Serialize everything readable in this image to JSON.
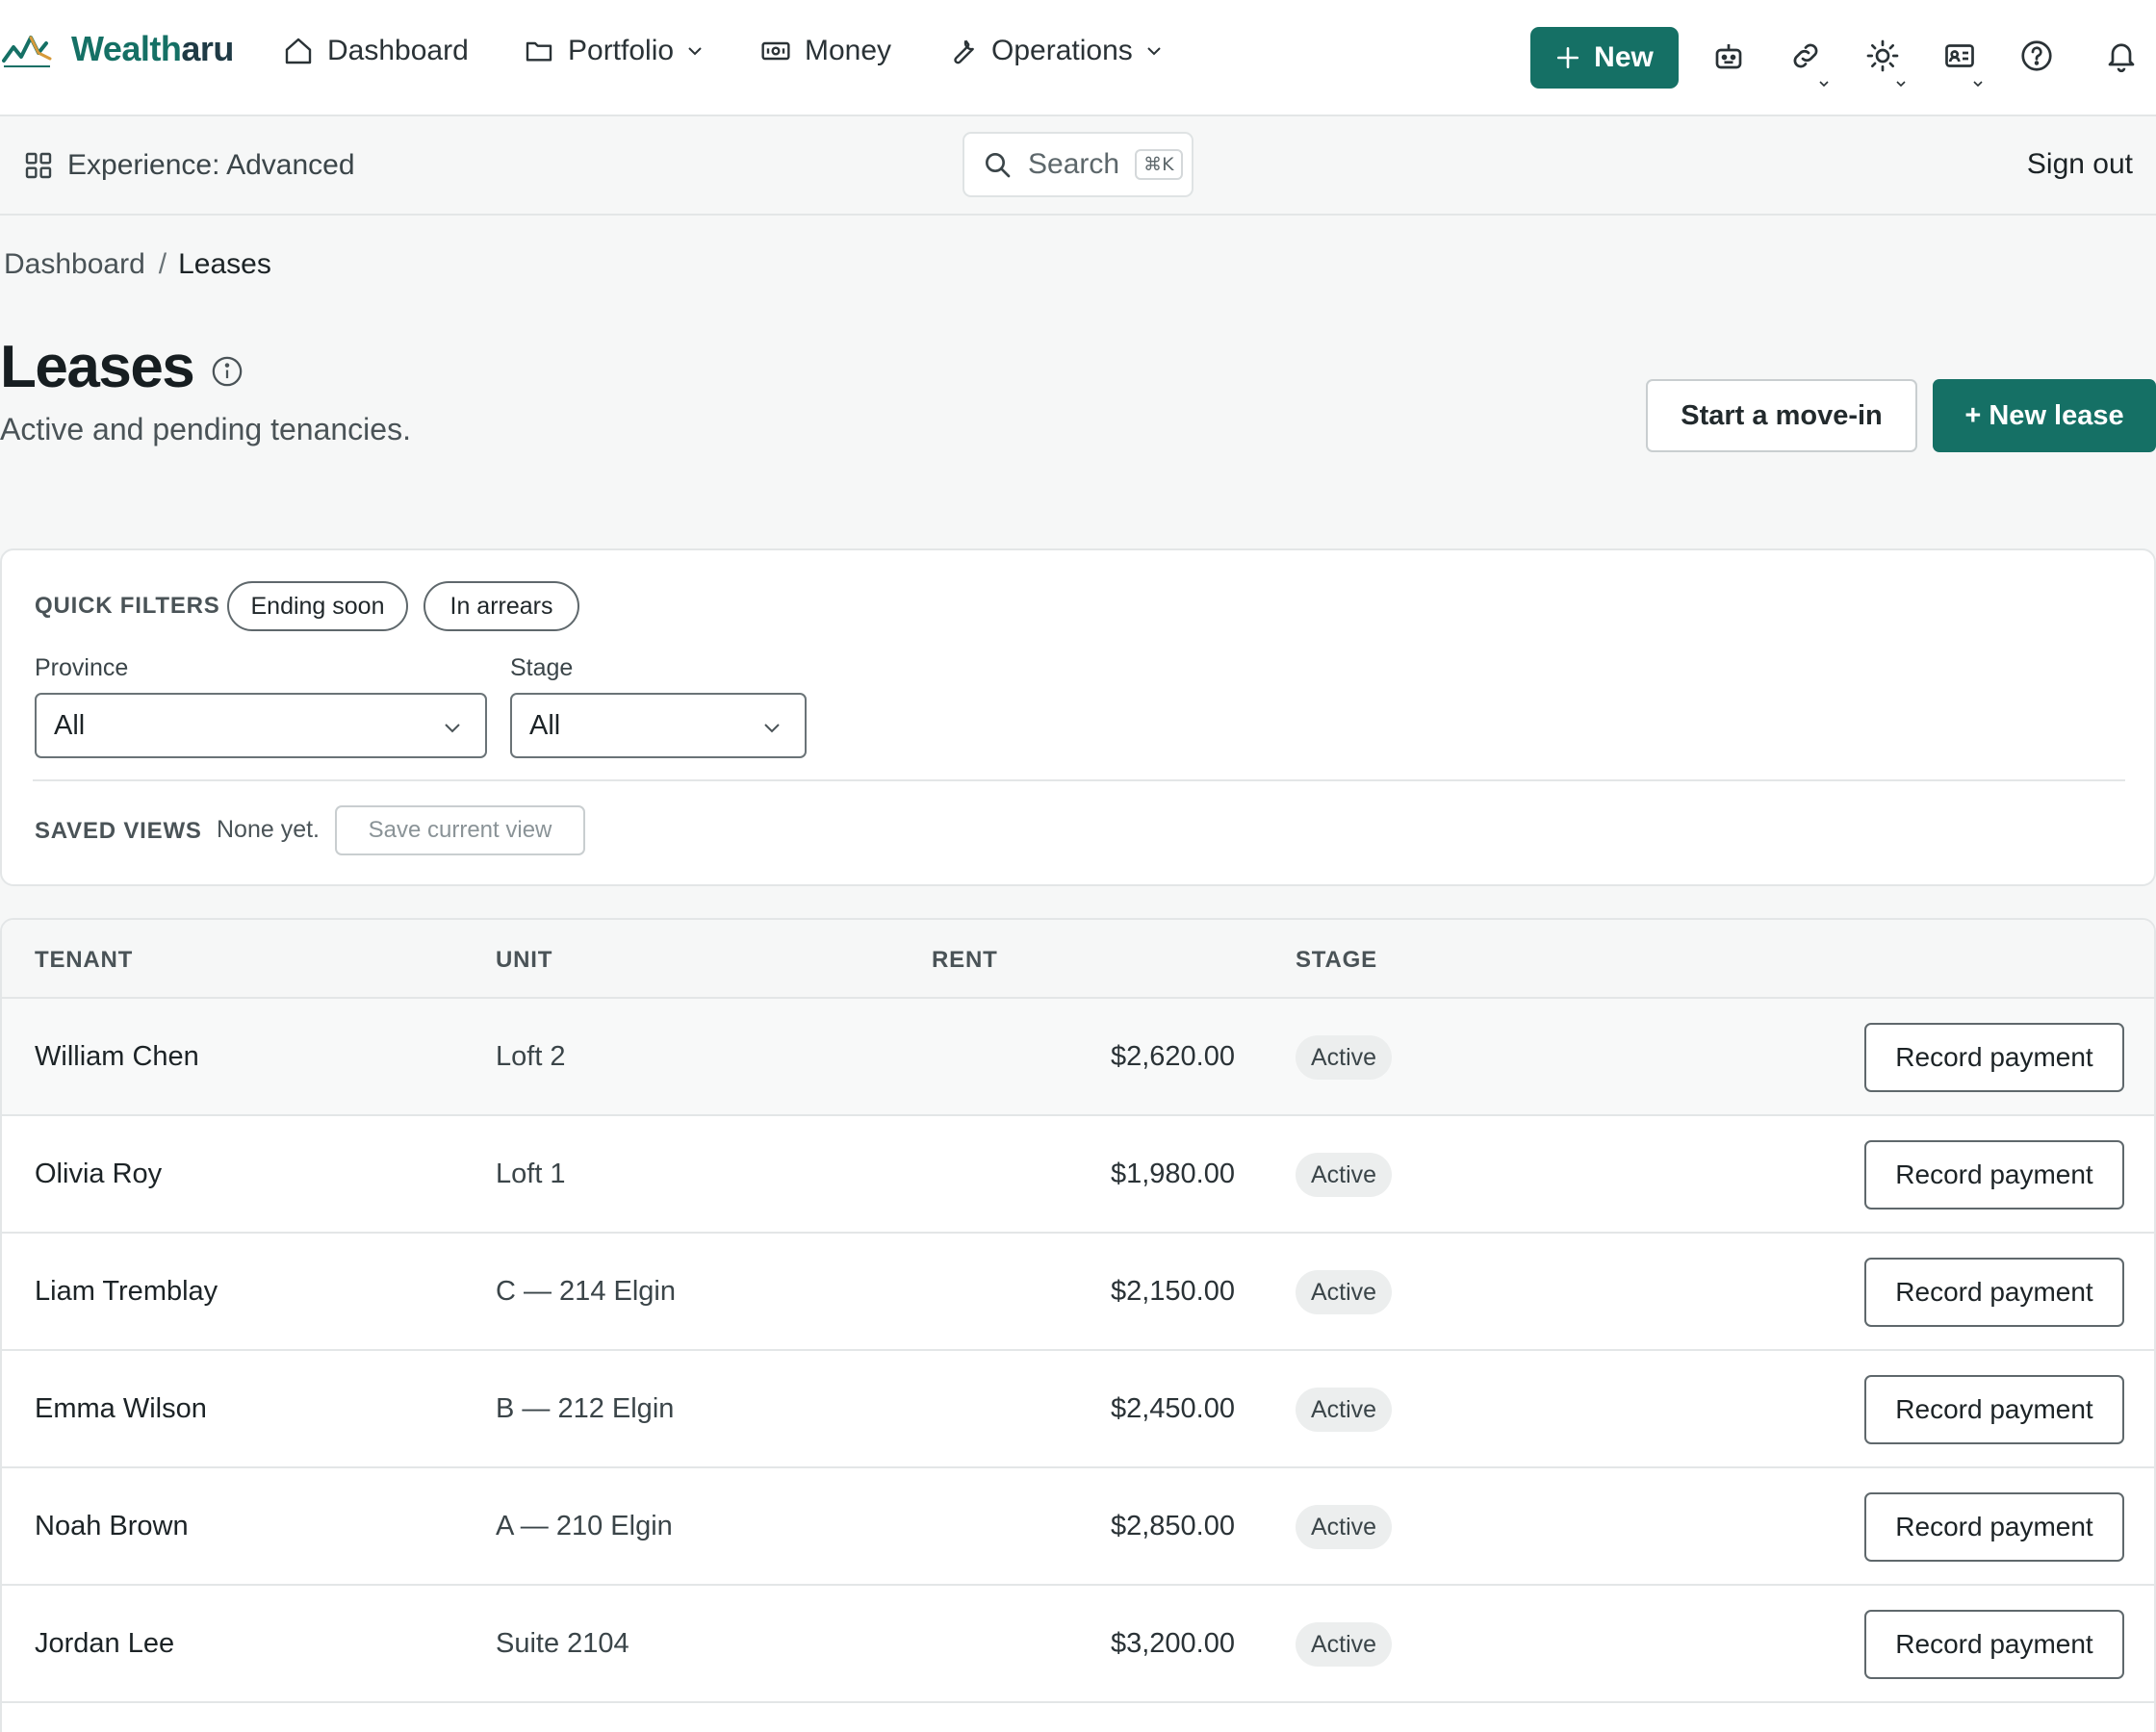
{
  "brand": {
    "name_part1": "Wealth",
    "name_part2": "aru"
  },
  "nav": {
    "dashboard": "Dashboard",
    "portfolio": "Portfolio",
    "money": "Money",
    "operations": "Operations",
    "new_label": "New"
  },
  "icons": {
    "assistant": "robot-icon",
    "links": "link-icon",
    "theme": "sun-icon",
    "profile": "id-card-icon",
    "help": "help-circle-icon",
    "notifications": "bell-icon"
  },
  "subbar": {
    "experience": "Experience: Advanced",
    "search_label": "Search",
    "search_shortcut": "⌘K",
    "sign_out": "Sign out"
  },
  "breadcrumb": {
    "root": "Dashboard",
    "separator": "/",
    "current": "Leases"
  },
  "page": {
    "title": "Leases",
    "subtitle": "Active and pending tenancies.",
    "start_move_in": "Start a move-in",
    "new_lease": "+ New lease"
  },
  "filters": {
    "quick_filters_label": "QUICK FILTERS",
    "chips": [
      "Ending soon",
      "In arrears"
    ],
    "province_label": "Province",
    "province_value": "All",
    "stage_label": "Stage",
    "stage_value": "All",
    "saved_views_label": "SAVED VIEWS",
    "saved_views_empty": "None yet.",
    "save_current_view": "Save current view"
  },
  "table": {
    "headers": {
      "tenant": "TENANT",
      "unit": "UNIT",
      "rent": "RENT",
      "stage": "STAGE"
    },
    "action_label": "Record payment",
    "rows": [
      {
        "tenant": "William Chen",
        "unit": "Loft 2",
        "rent": "$2,620.00",
        "stage": "Active"
      },
      {
        "tenant": "Olivia Roy",
        "unit": "Loft 1",
        "rent": "$1,980.00",
        "stage": "Active"
      },
      {
        "tenant": "Liam Tremblay",
        "unit": "C — 214 Elgin",
        "rent": "$2,150.00",
        "stage": "Active"
      },
      {
        "tenant": "Emma Wilson",
        "unit": "B — 212 Elgin",
        "rent": "$2,450.00",
        "stage": "Active"
      },
      {
        "tenant": "Noah Brown",
        "unit": "A — 210 Elgin",
        "rent": "$2,850.00",
        "stage": "Active"
      },
      {
        "tenant": "Jordan Lee",
        "unit": "Suite 2104",
        "rent": "$3,200.00",
        "stage": "Active"
      }
    ]
  },
  "colors": {
    "accent": "#157065",
    "brand_dark": "#1f3a45",
    "logo_orange": "#d79a3a"
  }
}
